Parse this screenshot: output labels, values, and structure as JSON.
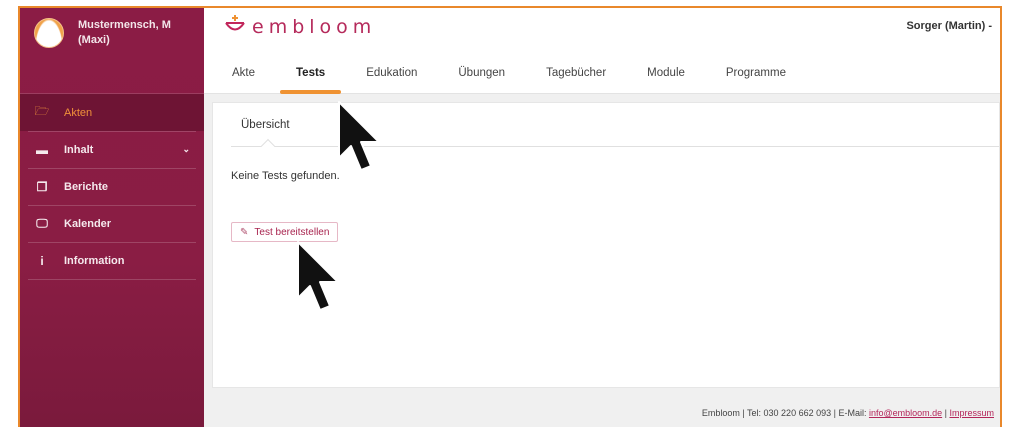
{
  "user": {
    "name": "Mustermensch, M (Maxi)"
  },
  "sidebar": {
    "items": [
      {
        "icon": "folder-icon",
        "glyph": "🗁",
        "label": "Akten",
        "active": true
      },
      {
        "icon": "content-icon",
        "glyph": "▬",
        "label": "Inhalt",
        "has_submenu": true
      },
      {
        "icon": "reports-icon",
        "glyph": "❐",
        "label": "Berichte"
      },
      {
        "icon": "calendar-icon",
        "glyph": "🖵",
        "label": "Kalender"
      },
      {
        "icon": "info-icon",
        "glyph": "i",
        "label": "Information"
      }
    ]
  },
  "header": {
    "logo_text": "embloom",
    "current_user": "Sorger (Martin) - ",
    "tabs": [
      {
        "label": "Akte"
      },
      {
        "label": "Tests",
        "active": true
      },
      {
        "label": "Edukation"
      },
      {
        "label": "Übungen"
      },
      {
        "label": "Tagebücher"
      },
      {
        "label": "Module"
      },
      {
        "label": "Programme"
      }
    ]
  },
  "main": {
    "subtab": "Übersicht",
    "empty_message": "Keine Tests gefunden.",
    "provide_button": {
      "icon": "edit-icon",
      "label": "Test bereitstellen"
    }
  },
  "footer": {
    "text": "Embloom | Tel: 030 220 662 093 | E-Mail: ",
    "email": "info@embloom.de",
    "sep": " | ",
    "impressum": "Impressum"
  },
  "colors": {
    "sidebar": "#8b1c45",
    "accent": "#ef9232",
    "brand": "#b52a5b"
  }
}
